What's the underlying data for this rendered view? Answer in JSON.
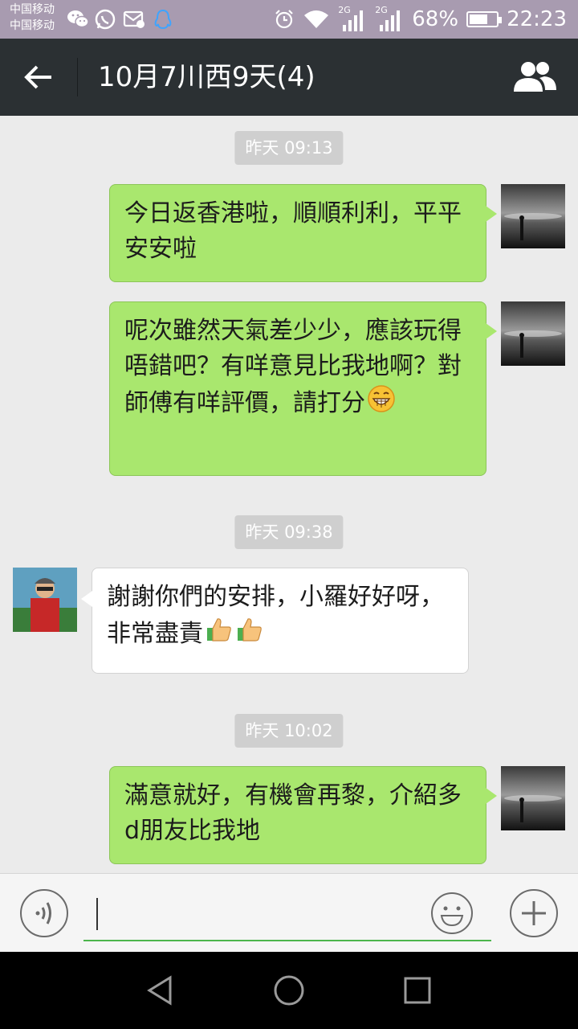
{
  "status_bar": {
    "carrier_1": "中国移动",
    "carrier_2": "中国移动",
    "network_1": "2G",
    "network_2": "2G",
    "battery_text": "68%",
    "battery_level": 0.68,
    "time": "22:23",
    "icons": [
      "wechat-icon",
      "whatsapp-icon",
      "mail-icon",
      "qq-icon",
      "alarm-icon",
      "wifi-icon",
      "signal-icon",
      "signal-icon",
      "battery-icon"
    ]
  },
  "header": {
    "title": "10月7川西9天(4)",
    "back_icon": "arrow-left-icon",
    "group_icon": "group-members-icon"
  },
  "messages": {
    "t1": "昨天 09:13",
    "m1": "今日返香港啦，順順利利，平平安安啦",
    "m2": "呢次雖然天氣差少少，應該玩得唔錯吧？有咩意見比我地啊？對師傅有咩評價，請打分",
    "m2_emoji": "grinning-face",
    "t2": "昨天 09:38",
    "m3": "謝謝你們的安排，小羅好好呀，非常盡責",
    "m3_emoji": "thumbs-up ×2",
    "t3": "昨天 10:02",
    "m4": "滿意就好，有機會再黎，介紹多d朋友比我地"
  },
  "input_bar": {
    "value": "",
    "voice_icon": "voice-icon",
    "emoji_icon": "emoji-icon",
    "plus_icon": "plus-icon"
  },
  "nav_bar": {
    "icons": [
      "back-triangle-icon",
      "home-circle-icon",
      "recents-square-icon"
    ]
  },
  "colors": {
    "status_bar": "#a89bb0",
    "title_bar": "#2b3033",
    "chat_background": "#ebebeb",
    "outgoing_bubble": "#a9e76e",
    "incoming_bubble": "#ffffff",
    "input_underline": "#4cb54c"
  }
}
